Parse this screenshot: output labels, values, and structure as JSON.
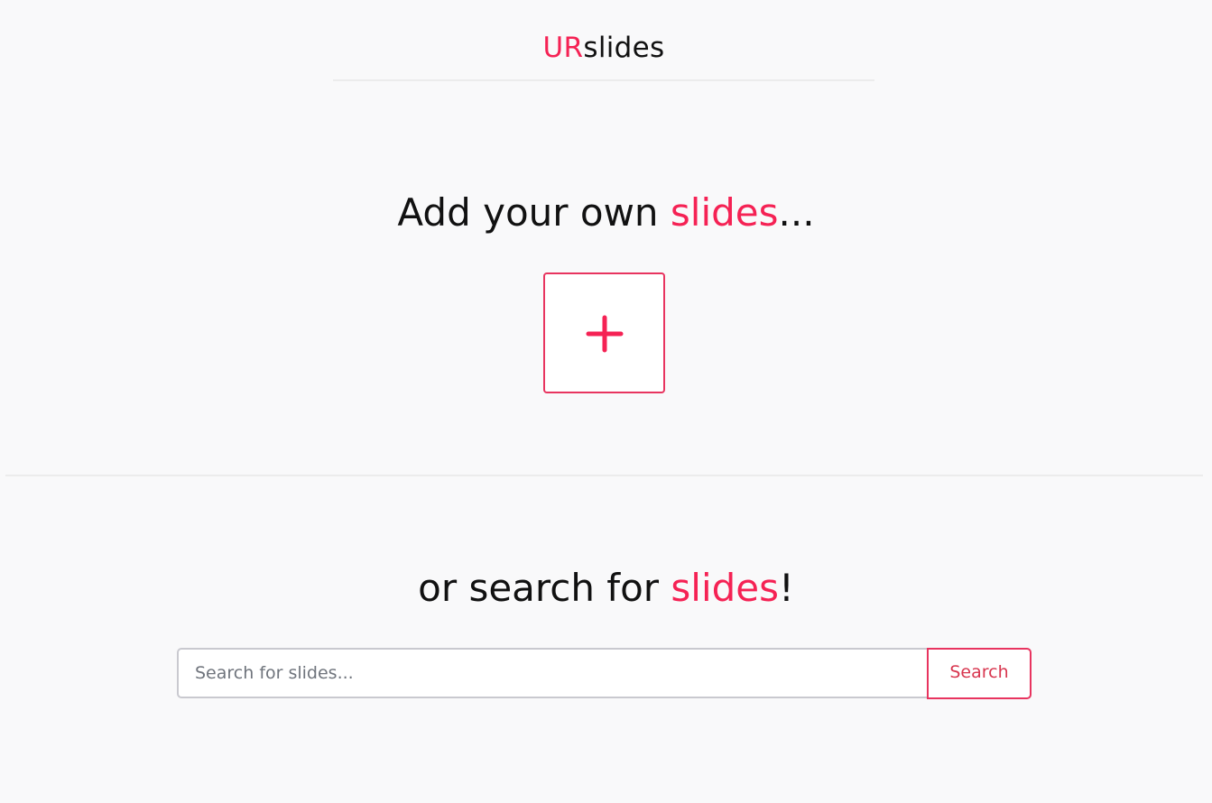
{
  "header": {
    "brand_accent": "UR",
    "brand_rest": "slides"
  },
  "add_section": {
    "heading_prefix": "Add your own ",
    "heading_accent": "slides",
    "heading_suffix": "...",
    "add_button_icon": "plus-icon"
  },
  "search_section": {
    "heading_prefix": "or search for ",
    "heading_accent": "slides",
    "heading_suffix": "!",
    "placeholder": "Search for slides...",
    "value": "",
    "button_label": "Search"
  },
  "colors": {
    "accent": "#f52254",
    "background": "#f9f9fa",
    "text": "#111111"
  }
}
